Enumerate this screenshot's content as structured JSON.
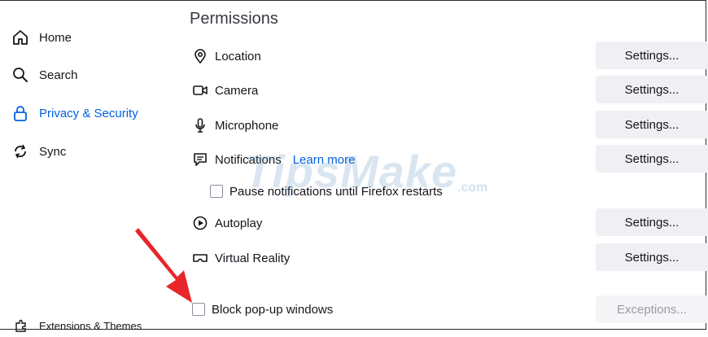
{
  "sidebar": {
    "items": [
      {
        "label": "Home",
        "icon": "home-icon"
      },
      {
        "label": "Search",
        "icon": "search-icon"
      },
      {
        "label": "Privacy & Security",
        "icon": "lock-icon",
        "active": true
      },
      {
        "label": "Sync",
        "icon": "sync-icon"
      }
    ],
    "footer": {
      "label": "Extensions & Themes",
      "icon": "puzzle-icon"
    }
  },
  "permissions": {
    "title": "Permissions",
    "rows": [
      {
        "label": "Location",
        "icon": "location-icon",
        "button": "Settings..."
      },
      {
        "label": "Camera",
        "icon": "camera-icon",
        "button": "Settings..."
      },
      {
        "label": "Microphone",
        "icon": "microphone-icon",
        "button": "Settings..."
      },
      {
        "label": "Notifications",
        "icon": "notifications-icon",
        "link": "Learn more",
        "button": "Settings..."
      },
      {
        "label": "Autoplay",
        "icon": "autoplay-icon",
        "button": "Settings..."
      },
      {
        "label": "Virtual Reality",
        "icon": "vr-headset-icon",
        "button": "Settings..."
      }
    ],
    "pause_notifications": {
      "label": "Pause notifications until Firefox restarts",
      "checked": false
    },
    "block_popups": {
      "label": "Block pop-up windows",
      "checked": false,
      "button": "Exceptions..."
    }
  },
  "watermark": {
    "text": "TipsMake",
    "suffix": ".com"
  },
  "colors": {
    "accent": "#0060df",
    "arrow": "#e8262a",
    "button_bg": "#f0f0f4"
  }
}
